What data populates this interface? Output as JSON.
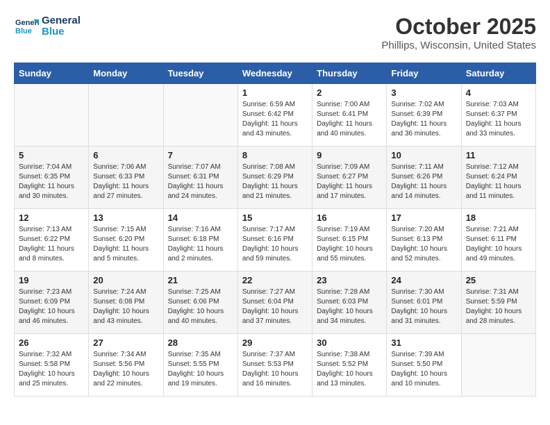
{
  "header": {
    "logo_line1": "General",
    "logo_line2": "Blue",
    "month": "October 2025",
    "location": "Phillips, Wisconsin, United States"
  },
  "weekdays": [
    "Sunday",
    "Monday",
    "Tuesday",
    "Wednesday",
    "Thursday",
    "Friday",
    "Saturday"
  ],
  "weeks": [
    [
      {
        "day": "",
        "sunrise": "",
        "sunset": "",
        "daylight": ""
      },
      {
        "day": "",
        "sunrise": "",
        "sunset": "",
        "daylight": ""
      },
      {
        "day": "",
        "sunrise": "",
        "sunset": "",
        "daylight": ""
      },
      {
        "day": "1",
        "sunrise": "Sunrise: 6:59 AM",
        "sunset": "Sunset: 6:42 PM",
        "daylight": "Daylight: 11 hours and 43 minutes."
      },
      {
        "day": "2",
        "sunrise": "Sunrise: 7:00 AM",
        "sunset": "Sunset: 6:41 PM",
        "daylight": "Daylight: 11 hours and 40 minutes."
      },
      {
        "day": "3",
        "sunrise": "Sunrise: 7:02 AM",
        "sunset": "Sunset: 6:39 PM",
        "daylight": "Daylight: 11 hours and 36 minutes."
      },
      {
        "day": "4",
        "sunrise": "Sunrise: 7:03 AM",
        "sunset": "Sunset: 6:37 PM",
        "daylight": "Daylight: 11 hours and 33 minutes."
      }
    ],
    [
      {
        "day": "5",
        "sunrise": "Sunrise: 7:04 AM",
        "sunset": "Sunset: 6:35 PM",
        "daylight": "Daylight: 11 hours and 30 minutes."
      },
      {
        "day": "6",
        "sunrise": "Sunrise: 7:06 AM",
        "sunset": "Sunset: 6:33 PM",
        "daylight": "Daylight: 11 hours and 27 minutes."
      },
      {
        "day": "7",
        "sunrise": "Sunrise: 7:07 AM",
        "sunset": "Sunset: 6:31 PM",
        "daylight": "Daylight: 11 hours and 24 minutes."
      },
      {
        "day": "8",
        "sunrise": "Sunrise: 7:08 AM",
        "sunset": "Sunset: 6:29 PM",
        "daylight": "Daylight: 11 hours and 21 minutes."
      },
      {
        "day": "9",
        "sunrise": "Sunrise: 7:09 AM",
        "sunset": "Sunset: 6:27 PM",
        "daylight": "Daylight: 11 hours and 17 minutes."
      },
      {
        "day": "10",
        "sunrise": "Sunrise: 7:11 AM",
        "sunset": "Sunset: 6:26 PM",
        "daylight": "Daylight: 11 hours and 14 minutes."
      },
      {
        "day": "11",
        "sunrise": "Sunrise: 7:12 AM",
        "sunset": "Sunset: 6:24 PM",
        "daylight": "Daylight: 11 hours and 11 minutes."
      }
    ],
    [
      {
        "day": "12",
        "sunrise": "Sunrise: 7:13 AM",
        "sunset": "Sunset: 6:22 PM",
        "daylight": "Daylight: 11 hours and 8 minutes."
      },
      {
        "day": "13",
        "sunrise": "Sunrise: 7:15 AM",
        "sunset": "Sunset: 6:20 PM",
        "daylight": "Daylight: 11 hours and 5 minutes."
      },
      {
        "day": "14",
        "sunrise": "Sunrise: 7:16 AM",
        "sunset": "Sunset: 6:18 PM",
        "daylight": "Daylight: 11 hours and 2 minutes."
      },
      {
        "day": "15",
        "sunrise": "Sunrise: 7:17 AM",
        "sunset": "Sunset: 6:16 PM",
        "daylight": "Daylight: 10 hours and 59 minutes."
      },
      {
        "day": "16",
        "sunrise": "Sunrise: 7:19 AM",
        "sunset": "Sunset: 6:15 PM",
        "daylight": "Daylight: 10 hours and 55 minutes."
      },
      {
        "day": "17",
        "sunrise": "Sunrise: 7:20 AM",
        "sunset": "Sunset: 6:13 PM",
        "daylight": "Daylight: 10 hours and 52 minutes."
      },
      {
        "day": "18",
        "sunrise": "Sunrise: 7:21 AM",
        "sunset": "Sunset: 6:11 PM",
        "daylight": "Daylight: 10 hours and 49 minutes."
      }
    ],
    [
      {
        "day": "19",
        "sunrise": "Sunrise: 7:23 AM",
        "sunset": "Sunset: 6:09 PM",
        "daylight": "Daylight: 10 hours and 46 minutes."
      },
      {
        "day": "20",
        "sunrise": "Sunrise: 7:24 AM",
        "sunset": "Sunset: 6:08 PM",
        "daylight": "Daylight: 10 hours and 43 minutes."
      },
      {
        "day": "21",
        "sunrise": "Sunrise: 7:25 AM",
        "sunset": "Sunset: 6:06 PM",
        "daylight": "Daylight: 10 hours and 40 minutes."
      },
      {
        "day": "22",
        "sunrise": "Sunrise: 7:27 AM",
        "sunset": "Sunset: 6:04 PM",
        "daylight": "Daylight: 10 hours and 37 minutes."
      },
      {
        "day": "23",
        "sunrise": "Sunrise: 7:28 AM",
        "sunset": "Sunset: 6:03 PM",
        "daylight": "Daylight: 10 hours and 34 minutes."
      },
      {
        "day": "24",
        "sunrise": "Sunrise: 7:30 AM",
        "sunset": "Sunset: 6:01 PM",
        "daylight": "Daylight: 10 hours and 31 minutes."
      },
      {
        "day": "25",
        "sunrise": "Sunrise: 7:31 AM",
        "sunset": "Sunset: 5:59 PM",
        "daylight": "Daylight: 10 hours and 28 minutes."
      }
    ],
    [
      {
        "day": "26",
        "sunrise": "Sunrise: 7:32 AM",
        "sunset": "Sunset: 5:58 PM",
        "daylight": "Daylight: 10 hours and 25 minutes."
      },
      {
        "day": "27",
        "sunrise": "Sunrise: 7:34 AM",
        "sunset": "Sunset: 5:56 PM",
        "daylight": "Daylight: 10 hours and 22 minutes."
      },
      {
        "day": "28",
        "sunrise": "Sunrise: 7:35 AM",
        "sunset": "Sunset: 5:55 PM",
        "daylight": "Daylight: 10 hours and 19 minutes."
      },
      {
        "day": "29",
        "sunrise": "Sunrise: 7:37 AM",
        "sunset": "Sunset: 5:53 PM",
        "daylight": "Daylight: 10 hours and 16 minutes."
      },
      {
        "day": "30",
        "sunrise": "Sunrise: 7:38 AM",
        "sunset": "Sunset: 5:52 PM",
        "daylight": "Daylight: 10 hours and 13 minutes."
      },
      {
        "day": "31",
        "sunrise": "Sunrise: 7:39 AM",
        "sunset": "Sunset: 5:50 PM",
        "daylight": "Daylight: 10 hours and 10 minutes."
      },
      {
        "day": "",
        "sunrise": "",
        "sunset": "",
        "daylight": ""
      }
    ]
  ]
}
